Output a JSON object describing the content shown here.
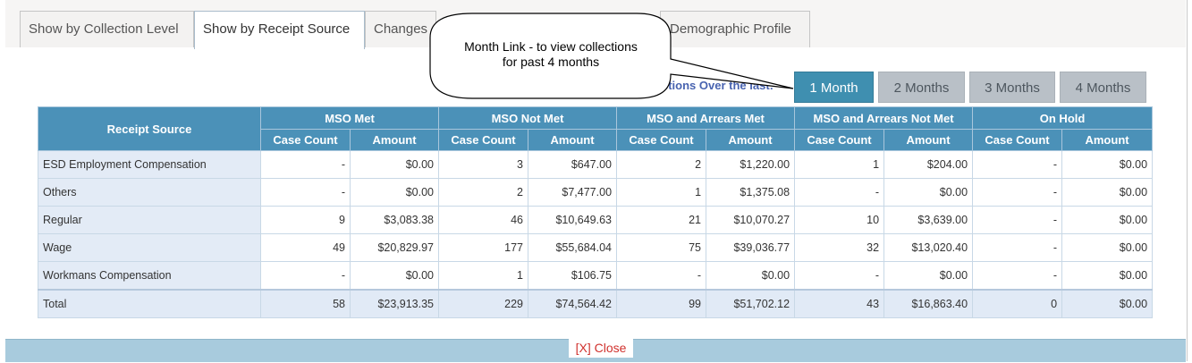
{
  "tabs": [
    {
      "label": "Show by Collection Level"
    },
    {
      "label": "Show by Receipt Source"
    },
    {
      "label": "Changes"
    },
    {
      "label": "Demographic Profile"
    }
  ],
  "range_label": "ctions Over the last:",
  "month_buttons": [
    "1 Month",
    "2 Months",
    "3 Months",
    "4 Months"
  ],
  "active_month": "1 Month",
  "callout": {
    "line1": "Month Link - to view collections",
    "line2": "for past 4 months"
  },
  "table": {
    "row_header": "Receipt Source",
    "groups": [
      "MSO Met",
      "MSO Not Met",
      "MSO and Arrears Met",
      "MSO and Arrears Not Met",
      "On Hold"
    ],
    "subheaders": [
      "Case Count",
      "Amount"
    ],
    "rows": [
      {
        "source": "ESD Employment Compensation",
        "values": [
          "-",
          "$0.00",
          "3",
          "$647.00",
          "2",
          "$1,220.00",
          "1",
          "$204.00",
          "-",
          "$0.00"
        ]
      },
      {
        "source": "Others",
        "values": [
          "-",
          "$0.00",
          "2",
          "$7,477.00",
          "1",
          "$1,375.08",
          "-",
          "$0.00",
          "-",
          "$0.00"
        ]
      },
      {
        "source": "Regular",
        "values": [
          "9",
          "$3,083.38",
          "46",
          "$10,649.63",
          "21",
          "$10,070.27",
          "10",
          "$3,639.00",
          "-",
          "$0.00"
        ]
      },
      {
        "source": "Wage",
        "values": [
          "49",
          "$20,829.97",
          "177",
          "$55,684.04",
          "75",
          "$39,036.77",
          "32",
          "$13,020.40",
          "-",
          "$0.00"
        ]
      },
      {
        "source": "Workmans Compensation",
        "values": [
          "-",
          "$0.00",
          "1",
          "$106.75",
          "-",
          "$0.00",
          "-",
          "$0.00",
          "-",
          "$0.00"
        ]
      }
    ],
    "total": {
      "source": "Total",
      "values": [
        "58",
        "$23,913.35",
        "229",
        "$74,564.42",
        "99",
        "$51,702.12",
        "43",
        "$16,863.40",
        "0",
        "$0.00"
      ]
    }
  },
  "close_label": "[X] Close",
  "colors": {
    "header_blue": "#4b91b8",
    "active_button": "#3f8fb0",
    "inactive_button": "#b9c0c7",
    "link_blue": "#4863b0",
    "close_red": "#d0312d",
    "footer": "#a8cbdd"
  }
}
